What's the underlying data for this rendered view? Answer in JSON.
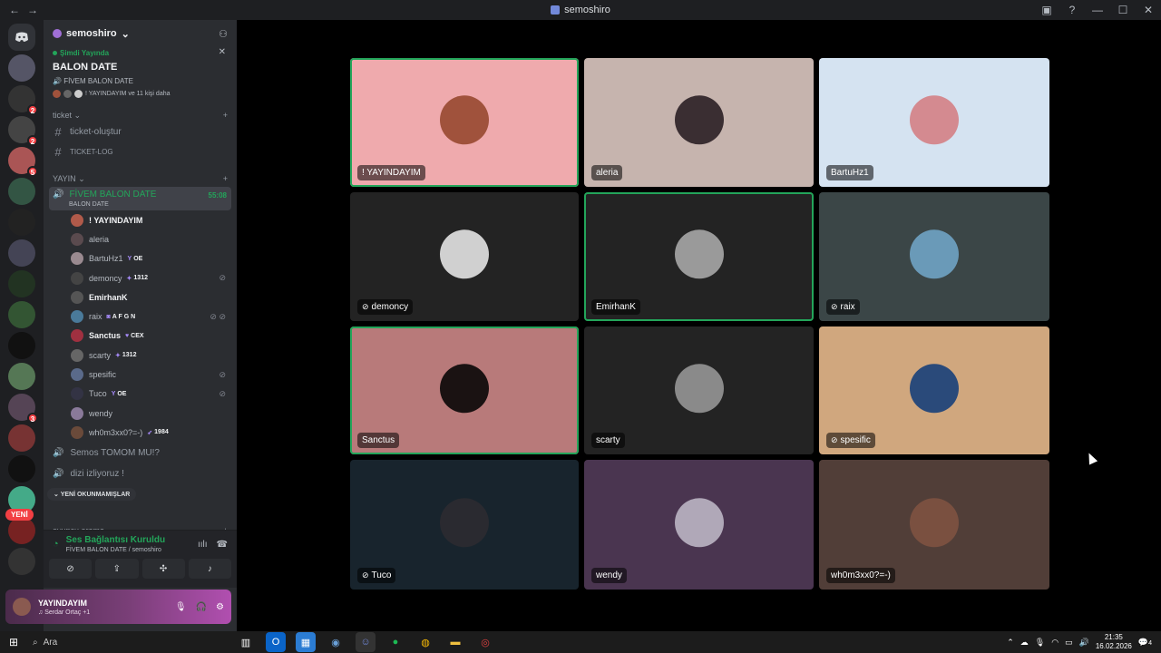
{
  "window": {
    "title": "semoshiro",
    "back": "←",
    "forward": "→",
    "controls": [
      "▣",
      "?",
      "—",
      "☐",
      "✕"
    ]
  },
  "rail": {
    "servers": [
      {
        "badge": ""
      },
      {
        "badge": "2"
      },
      {
        "badge": "2"
      },
      {
        "badge": "5"
      },
      {
        "badge": ""
      },
      {
        "badge": ""
      },
      {
        "badge": ""
      },
      {
        "badge": ""
      },
      {
        "badge": ""
      },
      {
        "badge": ""
      },
      {
        "badge": ""
      },
      {
        "badge": "3"
      },
      {
        "badge": ""
      },
      {
        "badge": ""
      },
      {
        "badge": ""
      },
      {
        "badge": ""
      },
      {
        "badge": ""
      }
    ],
    "new_label": "YENİ"
  },
  "guild": {
    "name": "semoshiro",
    "live": {
      "status": "Şimdi Yayında",
      "title": "BALON DATE",
      "channel": "FİVEM BALON DATE",
      "users_text": "! YAYINDAYIM ve 11 kişi daha"
    }
  },
  "categories": {
    "ticket": "ticket",
    "yayin": "YAYIN",
    "oyuncu": "oyuncu arama"
  },
  "channels": {
    "ticket_create": "ticket-oluştur",
    "ticket_log": "TICKET-LOG"
  },
  "voice_channel": {
    "name": "FİVEM BALON DATE",
    "sub": "BALON DATE",
    "timer": "55:08",
    "members": [
      {
        "name": "! YAYINDAYIM",
        "bold": true,
        "tag": "",
        "tag_icon": "",
        "icons": "",
        "color": "#b05a4a"
      },
      {
        "name": "aleria",
        "bold": false,
        "tag": "",
        "tag_icon": "",
        "icons": "",
        "color": "#5a4a4e"
      },
      {
        "name": "BartuHz1",
        "bold": false,
        "tag": "OE",
        "tag_icon": "Y",
        "icons": "",
        "color": "#9a8a90"
      },
      {
        "name": "demoncy",
        "bold": false,
        "tag": "1312",
        "tag_icon": "✦",
        "icons": "⊘",
        "color": "#444"
      },
      {
        "name": "EmirhanK",
        "bold": true,
        "tag": "",
        "tag_icon": "",
        "icons": "",
        "color": "#555"
      },
      {
        "name": "raix",
        "bold": false,
        "tag": "A F G N",
        "tag_icon": "◙",
        "icons": "⊘ ⊘",
        "color": "#4a7a9a"
      },
      {
        "name": "Sanctus",
        "bold": true,
        "tag": "CEX",
        "tag_icon": "♥",
        "icons": "",
        "color": "#a03040"
      },
      {
        "name": "scarty",
        "bold": false,
        "tag": "1312",
        "tag_icon": "✦",
        "icons": "",
        "color": "#666"
      },
      {
        "name": "spesific",
        "bold": false,
        "tag": "",
        "tag_icon": "",
        "icons": "⊘",
        "color": "#5a6a8a"
      },
      {
        "name": "Tuco",
        "bold": false,
        "tag": "OE",
        "tag_icon": "Y",
        "icons": "⊘",
        "color": "#334"
      },
      {
        "name": "wendy",
        "bold": false,
        "tag": "",
        "tag_icon": "",
        "icons": "",
        "color": "#8a7a9a"
      },
      {
        "name": "wh0m3xx0?=-)",
        "bold": false,
        "tag": "1984",
        "tag_icon": "➶",
        "icons": "",
        "color": "#6a4a3a"
      }
    ]
  },
  "voice_channels_other": [
    "Semos TOMOM MU!?",
    "dizi izliyoruz !"
  ],
  "unread_label": "YENİ OKUNMAMIŞLAR",
  "voice_panel": {
    "status": "Ses Bağlantısı Kuruldu",
    "location": "FİVEM BALON DATE / semoshiro"
  },
  "user_panel": {
    "name": "YAYINDAYIM",
    "activity": "♫ Serdar Ortaç +1"
  },
  "tiles": [
    {
      "name": "! YAYINDAYIM",
      "bg": "#efaaad",
      "avatar": "#a0523c",
      "speaking": true,
      "muted": false
    },
    {
      "name": "aleria",
      "bg": "#c6b4ae",
      "avatar": "#3a2e32",
      "speaking": false,
      "muted": false
    },
    {
      "name": "BartuHz1",
      "bg": "#d5e3f1",
      "avatar": "#d48a90",
      "speaking": false,
      "muted": false
    },
    {
      "name": "demoncy",
      "bg": "#232323",
      "avatar": "#d0d0d0",
      "speaking": false,
      "muted": true
    },
    {
      "name": "EmirhanK",
      "bg": "#232323",
      "avatar": "#9a9a9a",
      "speaking": true,
      "muted": false
    },
    {
      "name": "raix",
      "bg": "#3b4647",
      "avatar": "#6a9ab8",
      "speaking": false,
      "muted": true
    },
    {
      "name": "Sanctus",
      "bg": "#b87a7a",
      "avatar": "#1a1212",
      "speaking": true,
      "muted": false
    },
    {
      "name": "scarty",
      "bg": "#232323",
      "avatar": "#8a8a8a",
      "speaking": false,
      "muted": false
    },
    {
      "name": "spesific",
      "bg": "#d0a77e",
      "avatar": "#2a4a7a",
      "speaking": false,
      "muted": true
    },
    {
      "name": "Tuco",
      "bg": "#18242d",
      "avatar": "#2a2a30",
      "speaking": false,
      "muted": true
    },
    {
      "name": "wendy",
      "bg": "#4a3550",
      "avatar": "#b0a8b8",
      "speaking": false,
      "muted": false
    },
    {
      "name": "wh0m3xx0?=-)",
      "bg": "#513e38",
      "avatar": "#7a5040",
      "speaking": false,
      "muted": false
    }
  ],
  "taskbar": {
    "search_placeholder": "Ara",
    "time": "21:35",
    "date": "16.02.2026",
    "notif_count": "4"
  },
  "colors": {
    "accent_green": "#23a55a",
    "badge_red": "#f23f43"
  }
}
